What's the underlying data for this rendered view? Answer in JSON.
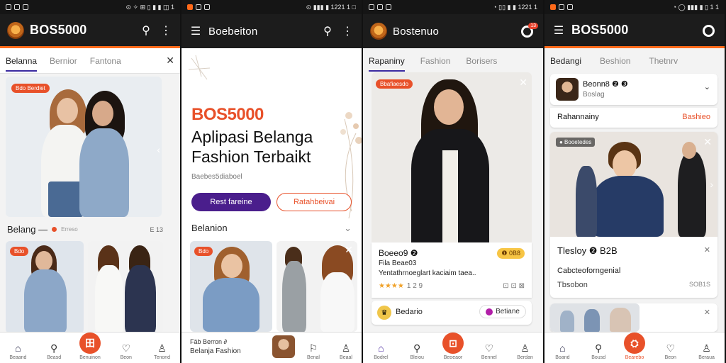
{
  "status": {
    "s1_right": "⊙ ✧ ⊞ ▯ ▮ ▮ ◫ 1",
    "s2_right": "⊙ ▮▮▮ ▮ 1221 1 □",
    "s3_right": "◔ ▯▯ ▮ ▮ 1221 1",
    "s4_right": "◔ ◯ ▮▮▮ ▮ ▯ 1 1"
  },
  "screen1": {
    "app_title": "BOS5000",
    "tabs": [
      "Belanna",
      "Bernior",
      "Fantona"
    ],
    "promo_tag": "Bdo Berdiet",
    "section_title": "Belang —",
    "section_meta": "Erreso",
    "section_count": "E 13",
    "small_tag": "Bdo",
    "nav": [
      {
        "label": "Beaand",
        "icon": "home"
      },
      {
        "label": "Beasd",
        "icon": "search"
      },
      {
        "label": "Benuinon",
        "icon": "center",
        "glyph": "田"
      },
      {
        "label": "Beon",
        "icon": "heart"
      },
      {
        "label": "Tenond",
        "icon": "person"
      }
    ]
  },
  "screen2": {
    "app_title": "Boebeiton",
    "brand": "BOS5000",
    "headline1": "Aplipasi Belanga",
    "headline2": "Fashion Terbaikt",
    "subtitle": "Baebes5diaboel",
    "primary_btn": "Rest fareine",
    "secondary_btn": "Ratahbeivai",
    "section_title": "Belanion",
    "tag": "Bdo",
    "footer_line1": "Fäb Berron ∂",
    "footer_line2": "Belanja Fashion",
    "nav": [
      {
        "label": "Benal",
        "icon": "bookmark"
      },
      {
        "label": "Beaal",
        "icon": "person"
      }
    ]
  },
  "screen3": {
    "app_title": "Bostenuo",
    "notif_count": "13",
    "tabs": [
      "Rapaniny",
      "Fashion",
      "Borisers"
    ],
    "promo_tag": "Bbafiaesdo",
    "product_title": "Boeeo9 ❷",
    "product_sub": "Fila Beae03",
    "product_desc": "Yentathrnoeglart kaciaim taea..",
    "rating_count": "1 2 9",
    "price_badge": "❶ 0B8",
    "side_icons": "⊡ ⊡ ⊠",
    "seller_name": "Bedario",
    "seller_btn": "Betiane",
    "nav": [
      {
        "label": "Bodrel",
        "icon": "home"
      },
      {
        "label": "Bleiou",
        "icon": "search"
      },
      {
        "label": "Beoeaor",
        "icon": "center",
        "glyph": "⊡"
      },
      {
        "label": "Bennel",
        "icon": "heart"
      },
      {
        "label": "Berdan",
        "icon": "person"
      }
    ]
  },
  "screen4": {
    "app_title": "BOS5000",
    "tabs": [
      "Bedangi",
      "Beshion",
      "Thetnrv"
    ],
    "user_name": "Beonn8 ❷ ❸",
    "user_sub": "Boslag",
    "row_label": "Rahannainy",
    "row_action": "Bashieo",
    "video_tag": "● Booetedes",
    "card_title": "Tlesloy ❷ B2B",
    "card_sub": "Cabcteoforngenial",
    "card_meta": "Tbsobon",
    "card_count": "SOB1S",
    "nav": [
      {
        "label": "Boand",
        "icon": "home"
      },
      {
        "label": "Bousd",
        "icon": "search"
      },
      {
        "label": "Bearebo",
        "icon": "center",
        "glyph": "⛭"
      },
      {
        "label": "Beon",
        "icon": "heart"
      },
      {
        "label": "Beraua",
        "icon": "person"
      }
    ]
  },
  "colors": {
    "accent": "#e8512a",
    "brand_purple": "#4a1e8c",
    "dark_bar": "#1c1c1c"
  }
}
